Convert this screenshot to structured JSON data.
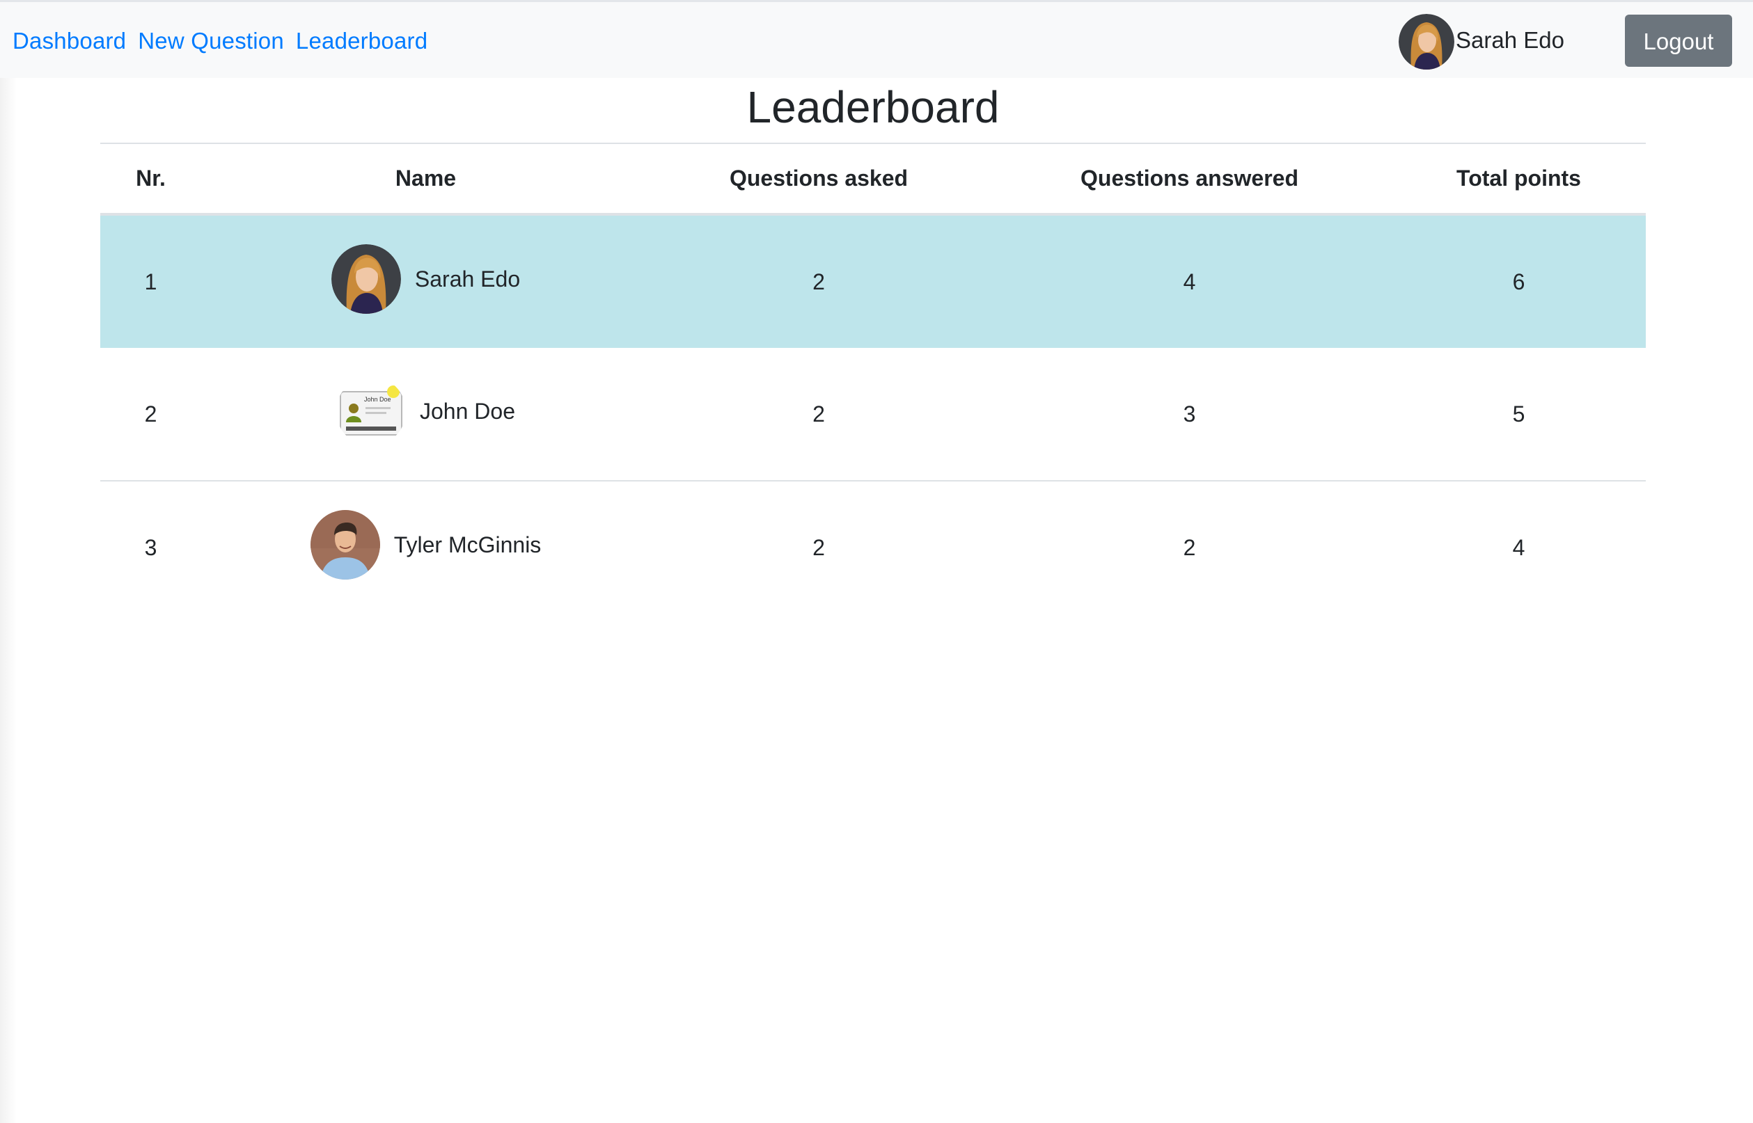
{
  "nav": {
    "links": [
      "Dashboard",
      "New Question",
      "Leaderboard"
    ],
    "user_name": "Sarah Edo",
    "logout_label": "Logout"
  },
  "page": {
    "title": "Leaderboard"
  },
  "table": {
    "headers": [
      "Nr.",
      "Name",
      "Questions asked",
      "Questions answered",
      "Total points"
    ],
    "rows": [
      {
        "nr": "1",
        "name": "Sarah Edo",
        "avatar": "woman-portrait-avatar",
        "asked": "2",
        "answered": "4",
        "points": "6"
      },
      {
        "nr": "2",
        "name": "John Doe",
        "avatar": "id-card-avatar",
        "asked": "2",
        "answered": "3",
        "points": "5"
      },
      {
        "nr": "3",
        "name": "Tyler McGinnis",
        "avatar": "man-portrait-avatar",
        "asked": "2",
        "answered": "2",
        "points": "4"
      }
    ]
  },
  "colors": {
    "link": "#007bff",
    "navbar_bg": "#f8f9fa",
    "logout_bg": "#6c757d",
    "highlight_row": "#bee5eb",
    "border": "#dee2e6"
  }
}
